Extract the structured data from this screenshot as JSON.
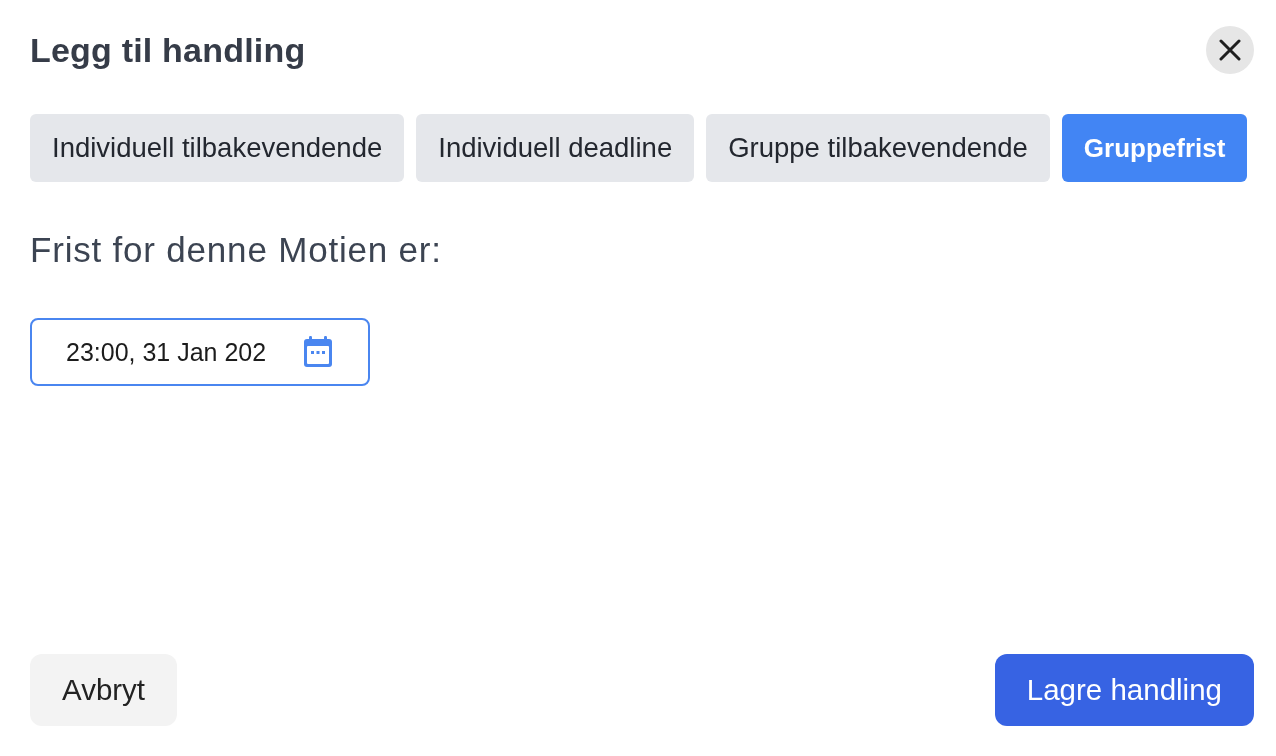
{
  "dialog": {
    "title": "Legg til handling"
  },
  "tabs": [
    {
      "label": "Individuell tilbakevendende",
      "selected": false
    },
    {
      "label": "Individuell deadline",
      "selected": false
    },
    {
      "label": "Gruppe tilbakevendende",
      "selected": false
    },
    {
      "label": "Gruppefrist",
      "selected": true
    }
  ],
  "deadline": {
    "label": "Frist for denne Motien er:",
    "value": "23:00, 31 Jan 202"
  },
  "buttons": [
    {
      "label": "Avbryt",
      "kind": "secondary"
    },
    {
      "label": "Lagre handling",
      "kind": "primary"
    }
  ]
}
